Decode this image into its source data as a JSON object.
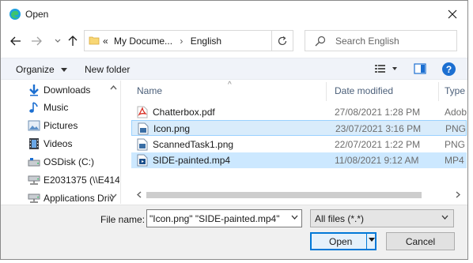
{
  "window": {
    "title": "Open"
  },
  "address": {
    "prefix": "«",
    "segments": [
      "My Docume...",
      "English"
    ]
  },
  "search": {
    "placeholder": "Search English"
  },
  "toolbar": {
    "organize_label": "Organize",
    "new_folder_label": "New folder",
    "help_label": "?"
  },
  "nav": {
    "items": [
      {
        "label": "Downloads",
        "icon": "download-arrow-icon"
      },
      {
        "label": "Music",
        "icon": "music-note-icon"
      },
      {
        "label": "Pictures",
        "icon": "pictures-icon"
      },
      {
        "label": "Videos",
        "icon": "film-icon"
      },
      {
        "label": "OSDisk (C:)",
        "icon": "drive-icon"
      },
      {
        "label": "E2031375 (\\\\E414",
        "icon": "network-drive-icon"
      },
      {
        "label": "Applications Driv",
        "icon": "network-drive-icon"
      }
    ]
  },
  "columns": {
    "name": "Name",
    "date": "Date modified",
    "type": "Type"
  },
  "files": [
    {
      "name": "Chatterbox.pdf",
      "date": "27/08/2021 1:28 PM",
      "type": "Adob",
      "icon": "pdf-icon",
      "selected": false
    },
    {
      "name": "Icon.png",
      "date": "23/07/2021 3:16 PM",
      "type": "PNG",
      "icon": "image-file-icon",
      "selected": true
    },
    {
      "name": "ScannedTask1.png",
      "date": "22/07/2021 1:22 PM",
      "type": "PNG",
      "icon": "image-file-icon",
      "selected": false
    },
    {
      "name": "SIDE-painted.mp4",
      "date": "11/08/2021 9:12 AM",
      "type": "MP4",
      "icon": "video-file-icon",
      "selected": true
    }
  ],
  "bottom": {
    "file_name_label": "File name:",
    "file_name_value": "\"Icon.png\" \"SIDE-painted.mp4\"",
    "file_type_value": "All files (*.*)",
    "open_label": "Open",
    "cancel_label": "Cancel"
  },
  "colors": {
    "accent": "#0078d7",
    "selection": "#cce8ff",
    "folder": "#f8d775"
  }
}
